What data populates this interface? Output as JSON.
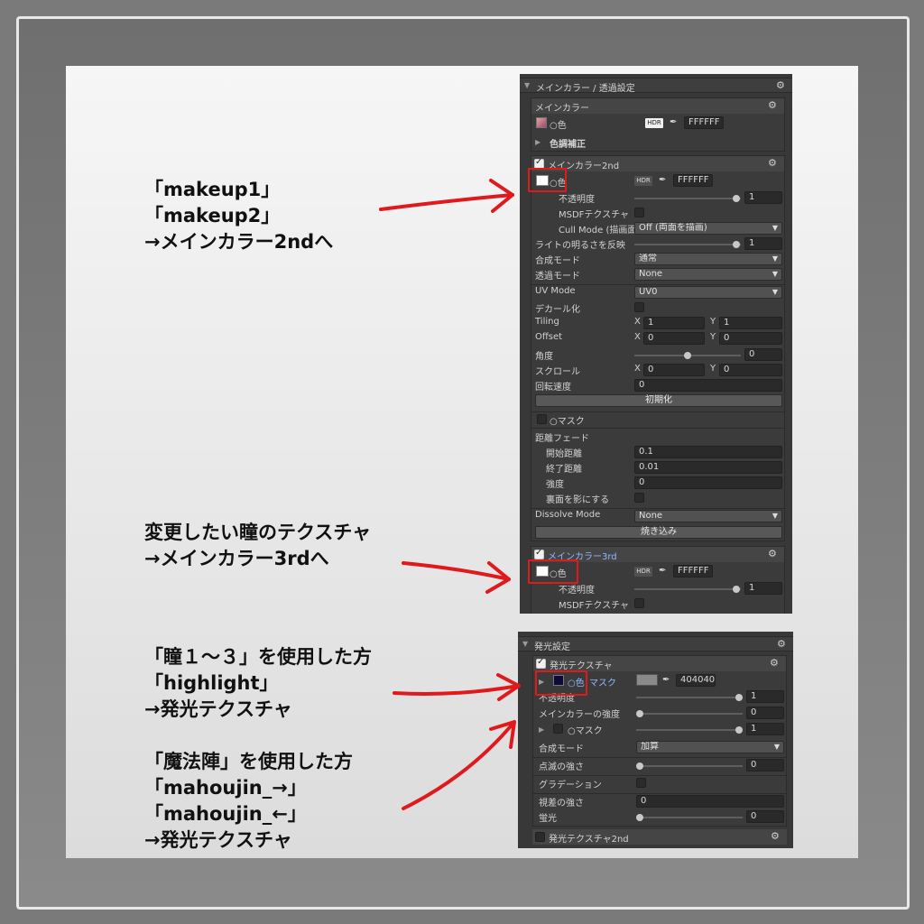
{
  "notes": {
    "note1": [
      "「makeup1」",
      "「makeup2」",
      "→メインカラー2ndへ"
    ],
    "note2": [
      "変更したい瞳のテクスチャ",
      "→メインカラー3rdへ"
    ],
    "note3": [
      "「瞳１～３」を使用した方",
      "「highlight」",
      "→発光テクスチャ"
    ],
    "note4": [
      "「魔法陣」を使用した方",
      "「mahoujin_→」",
      "「mahoujin_←」",
      "→発光テクスチャ"
    ]
  },
  "panel_top": {
    "section_title": "メインカラー / 透過設定",
    "main_color": {
      "title": "メインカラー",
      "color_label": "○色",
      "hdr": "HDR",
      "hex": "FFFFFF",
      "tone_correction": "色調補正"
    },
    "main2": {
      "title": "メインカラー2nd",
      "color_label": "○色",
      "hdr": "HDR",
      "hex": "FFFFFF",
      "opacity_label": "不透明度",
      "opacity_value": "1",
      "msdf_label": "MSDFテクスチャ",
      "cull_label": "Cull Mode (描画面",
      "cull_value": "Off (両面を描画)",
      "light_label": "ライトの明るさを反映",
      "light_value": "1",
      "blend_label": "合成モード",
      "blend_value": "通常",
      "alpha_label": "透過モード",
      "alpha_value": "None",
      "uv_label": "UV Mode",
      "uv_value": "UV0",
      "decal_label": "デカール化",
      "tiling_label": "Tiling",
      "tiling_x": "1",
      "tiling_y": "1",
      "offset_label": "Offset",
      "offset_x": "0",
      "offset_y": "0",
      "angle_label": "角度",
      "angle_value": "0",
      "scroll_label": "スクロール",
      "scroll_x": "0",
      "scroll_y": "0",
      "rotspeed_label": "回転速度",
      "rotspeed_value": "0",
      "reset_button": "初期化",
      "mask_label": "○マスク",
      "distfade_label": "距離フェード",
      "start_label": "開始距離",
      "start_value": "0.1",
      "end_label": "終了距離",
      "end_value": "0.01",
      "strength_label": "強度",
      "strength_value": "0",
      "backface_label": "裏面を影にする",
      "dissolve_label": "Dissolve Mode",
      "dissolve_value": "None",
      "bake_button": "焼き込み",
      "x_axis": "X",
      "y_axis": "Y"
    },
    "main3": {
      "title": "メインカラー3rd",
      "color_label": "○色",
      "hdr": "HDR",
      "hex": "FFFFFF",
      "opacity_label": "不透明度",
      "opacity_value": "1",
      "msdf_label": "MSDFテクスチャ"
    }
  },
  "panel_bottom": {
    "section_title": "発光設定",
    "emission": {
      "title": "発光テクスチャ",
      "color_label": "○色",
      "mask_link": "マスク",
      "hex": "404040",
      "opacity_label": "不透明度",
      "opacity_value": "1",
      "main_strength_label": "メインカラーの強度",
      "main_strength_value": "0",
      "mask_label": "○マスク",
      "mask_value": "1",
      "blend_label": "合成モード",
      "blend_value": "加算",
      "blink_label": "点滅の強さ",
      "blink_value": "0",
      "gradation_label": "グラデーション",
      "parallax_label": "視差の強さ",
      "parallax_value": "0",
      "fluor_label": "蛍光",
      "fluor_value": "0"
    },
    "emission2_title": "発光テクスチャ2nd"
  },
  "colors": {
    "panel_bg": "#383838",
    "highlight_red": "#e0191c",
    "link_blue": "#8fb8ff",
    "emission_color": "#0d0a3a",
    "emission_swatch": "#404040"
  }
}
